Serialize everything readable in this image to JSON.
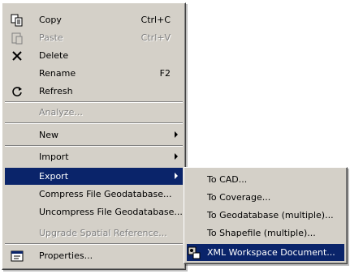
{
  "main_menu": {
    "copy": {
      "label": "Copy",
      "shortcut": "Ctrl+C"
    },
    "paste": {
      "label": "Paste",
      "shortcut": "Ctrl+V"
    },
    "delete": {
      "label": "Delete"
    },
    "rename": {
      "label": "Rename",
      "shortcut": "F2"
    },
    "refresh": {
      "label": "Refresh"
    },
    "analyze": {
      "label": "Analyze..."
    },
    "new": {
      "label": "New"
    },
    "import": {
      "label": "Import"
    },
    "export": {
      "label": "Export"
    },
    "compress": {
      "label": "Compress File Geodatabase..."
    },
    "uncompress": {
      "label": "Uncompress File Geodatabase..."
    },
    "upgrade": {
      "label": "Upgrade Spatial Reference..."
    },
    "properties": {
      "label": "Properties..."
    }
  },
  "export_submenu": {
    "to_cad": "To CAD...",
    "to_coverage": "To Coverage...",
    "to_geodatabase": "To Geodatabase (multiple)...",
    "to_shapefile": "To Shapefile (multiple)...",
    "xml_workspace": "XML Workspace Document..."
  },
  "colors": {
    "menu_bg": "#d4d0c8",
    "highlight": "#0a246a",
    "disabled_text": "#808080"
  }
}
